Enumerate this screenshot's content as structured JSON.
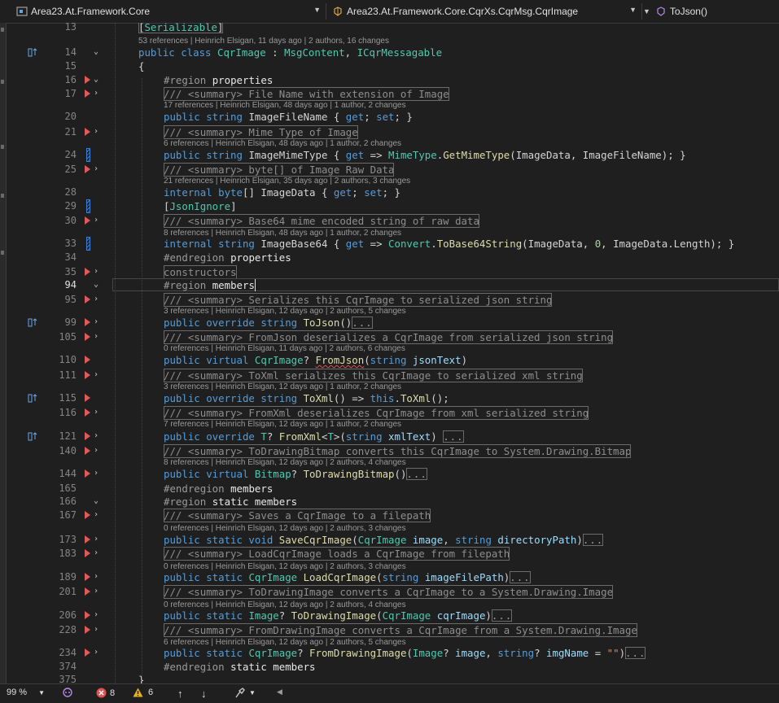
{
  "navbar": {
    "project": "Area23.At.Framework.Core",
    "type": "Area23.At.Framework.Core.CqrXs.CqrMsg.CqrImage",
    "member": "ToJson()"
  },
  "statusbar": {
    "zoom": "99 %",
    "errors": "8",
    "warnings": "6"
  },
  "colors": {
    "keyword": "#569cd6",
    "type": "#4ec9b0",
    "method": "#dcdcaa",
    "param": "#9cdcfe",
    "breakpoint": "#e05a5a"
  },
  "lines": [
    {
      "ln": "13",
      "code": "[Serializable]"
    },
    {
      "lens": "53 references | Heinrich Elsigan, 11 days ago | 2 authors, 16 changes"
    },
    {
      "ln": "14",
      "code": "public class CqrImage : MsgContent, ICqrMessagable"
    },
    {
      "ln": "15",
      "code": "{"
    },
    {
      "ln": "16",
      "code": "#region properties"
    },
    {
      "ln": "17",
      "code": "/// <summary> File Name with extension of Image"
    },
    {
      "lens": "17 references | Heinrich Elsigan, 48 days ago | 1 author, 2 changes"
    },
    {
      "ln": "20",
      "code": "public string ImageFileName { get; set; }"
    },
    {
      "ln": "21",
      "code": "/// <summary> Mime Type of Image"
    },
    {
      "lens": "6 references | Heinrich Elsigan, 48 days ago | 1 author, 2 changes"
    },
    {
      "ln": "24",
      "code": "public string ImageMimeType { get => MimeType.GetMimeType(ImageData, ImageFileName); }"
    },
    {
      "ln": "25",
      "code": "/// <summary> byte[] of Image Raw Data"
    },
    {
      "lens": "21 references | Heinrich Elsigan, 35 days ago | 2 authors, 3 changes"
    },
    {
      "ln": "28",
      "code": "internal byte[] ImageData { get; set; }"
    },
    {
      "ln": "29",
      "code": "[JsonIgnore]"
    },
    {
      "ln": "30",
      "code": "/// <summary> Base64 mime encoded string of raw data"
    },
    {
      "lens": "8 references | Heinrich Elsigan, 48 days ago | 1 author, 2 changes"
    },
    {
      "ln": "33",
      "code": "internal string ImageBase64 { get => Convert.ToBase64String(ImageData, 0, ImageData.Length); }"
    },
    {
      "ln": "34",
      "code": "#endregion properties"
    },
    {
      "ln": "35",
      "code": "constructors"
    },
    {
      "ln": "94",
      "code": "#region members"
    },
    {
      "ln": "95",
      "code": "/// <summary> Serializes this CqrImage to serialized json string"
    },
    {
      "lens": "3 references | Heinrich Elsigan, 12 days ago | 2 authors, 5 changes"
    },
    {
      "ln": "99",
      "code": "public override string ToJson()"
    },
    {
      "ln": "105",
      "code": "/// <summary> FromJson deserializes a CqrImage from serialized json string"
    },
    {
      "lens": "0 references | Heinrich Elsigan, 11 days ago | 2 authors, 6 changes"
    },
    {
      "ln": "110",
      "code": "public virtual CqrImage? FromJson(string jsonText)"
    },
    {
      "ln": "111",
      "code": "/// <summary> ToXml serializes this CqrImage to serialized xml string"
    },
    {
      "lens": "3 references | Heinrich Elsigan, 12 days ago | 1 author, 2 changes"
    },
    {
      "ln": "115",
      "code": "public override string ToXml() => this.ToXml();"
    },
    {
      "ln": "116",
      "code": "/// <summary> FromXml deserializes CqrImage from xml serialized string"
    },
    {
      "lens": "7 references | Heinrich Elsigan, 12 days ago | 1 author, 2 changes"
    },
    {
      "ln": "121",
      "code": "public override T? FromXml<T>(string xmlText)"
    },
    {
      "ln": "140",
      "code": "/// <summary> ToDrawingBitmap converts this CqrImage to System.Drawing.Bitmap"
    },
    {
      "lens": "8 references | Heinrich Elsigan, 12 days ago | 2 authors, 4 changes"
    },
    {
      "ln": "144",
      "code": "public virtual Bitmap? ToDrawingBitmap()"
    },
    {
      "ln": "165",
      "code": "#endregion members"
    },
    {
      "ln": "166",
      "code": "#region static members"
    },
    {
      "ln": "167",
      "code": "/// <summary> Saves a CqrImage to a filepath"
    },
    {
      "lens": "0 references | Heinrich Elsigan, 12 days ago | 2 authors, 3 changes"
    },
    {
      "ln": "173",
      "code": "public static void SaveCqrImage(CqrImage image, string directoryPath)"
    },
    {
      "ln": "183",
      "code": "/// <summary> LoadCqrImage loads a CqrImage from filepath"
    },
    {
      "lens": "0 references | Heinrich Elsigan, 12 days ago | 2 authors, 3 changes"
    },
    {
      "ln": "189",
      "code": "public static CqrImage LoadCqrImage(string imageFilePath)"
    },
    {
      "ln": "201",
      "code": "/// <summary> ToDrawingImage converts a CqrImage to a System.Drawing.Image"
    },
    {
      "lens": "0 references | Heinrich Elsigan, 12 days ago | 2 authors, 4 changes"
    },
    {
      "ln": "206",
      "code": "public static Image? ToDrawingImage(CqrImage cqrImage)"
    },
    {
      "ln": "228",
      "code": "/// <summary> FromDrawingImage converts a CqrImage from a System.Drawing.Image"
    },
    {
      "lens": "6 references | Heinrich Elsigan, 12 days ago | 2 authors, 5 changes"
    },
    {
      "ln": "234",
      "code": "public static CqrImage? FromDrawingImage(Image? image, string? imgName = \"\")"
    },
    {
      "ln": "374",
      "code": "#endregion static members"
    },
    {
      "ln": "375",
      "code": "}"
    }
  ]
}
